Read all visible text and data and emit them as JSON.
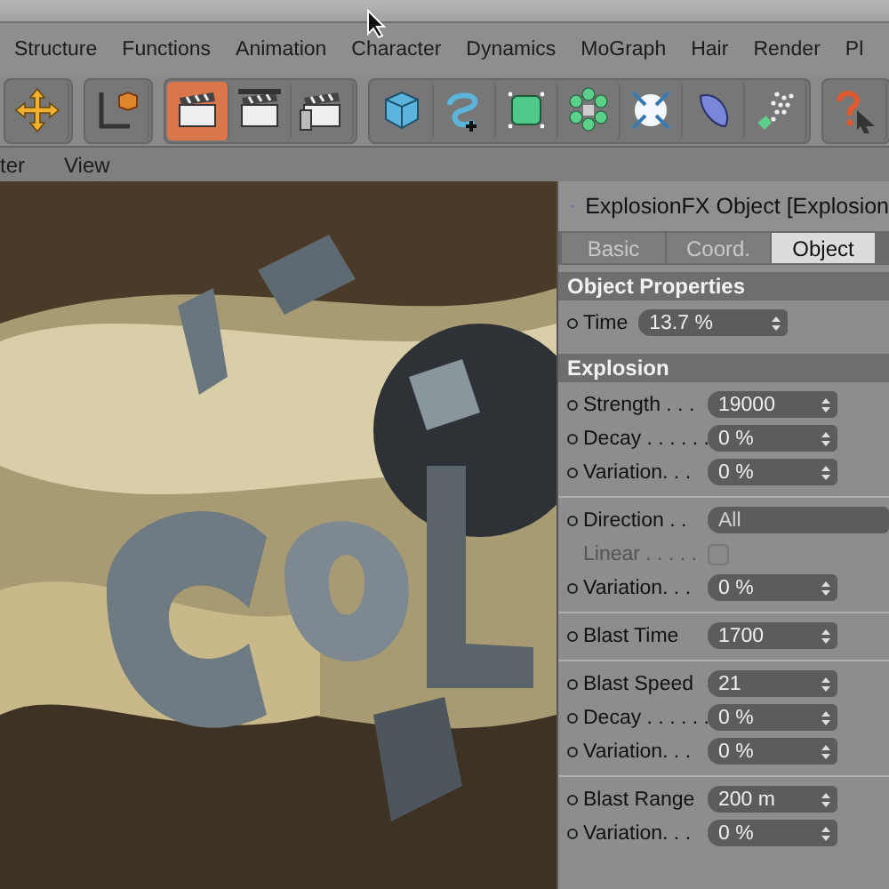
{
  "menu_bar": {
    "items": [
      "Structure",
      "Functions",
      "Animation",
      "Character",
      "Dynamics",
      "MoGraph",
      "Hair",
      "Render",
      "Pl"
    ]
  },
  "toolbar": {
    "groups": [
      {
        "buttons": [
          {
            "kind": "move",
            "selected": false
          }
        ]
      },
      {
        "buttons": [
          {
            "kind": "axis",
            "selected": false
          }
        ]
      },
      {
        "buttons": [
          {
            "kind": "render-view",
            "selected": true
          },
          {
            "kind": "render-picture",
            "selected": false
          },
          {
            "kind": "render-settings",
            "selected": false
          }
        ]
      },
      {
        "buttons": [
          {
            "kind": "cube",
            "selected": false
          },
          {
            "kind": "spline",
            "selected": false
          },
          {
            "kind": "nurbs",
            "selected": false
          },
          {
            "kind": "array",
            "selected": false
          },
          {
            "kind": "deformer",
            "selected": false
          },
          {
            "kind": "half-sphere",
            "selected": false
          },
          {
            "kind": "particles",
            "selected": false
          }
        ]
      },
      {
        "buttons": [
          {
            "kind": "help",
            "selected": false
          }
        ]
      }
    ]
  },
  "viewport_menu": {
    "items": [
      "ter",
      "View"
    ]
  },
  "attributes": {
    "title": "ExplosionFX Object [Explosion",
    "tabs": [
      {
        "label": "Basic",
        "selected": false
      },
      {
        "label": "Coord.",
        "selected": false
      },
      {
        "label": "Object",
        "selected": true
      }
    ],
    "sections": [
      {
        "title": "Object Properties",
        "groups": [
          [
            {
              "kind": "number",
              "label": "Time",
              "value": "13.7 %",
              "compact": true,
              "keyframe_dot": true
            }
          ]
        ]
      },
      {
        "title": "Explosion",
        "groups": [
          [
            {
              "kind": "number",
              "label": "Strength . . .",
              "value": "19000",
              "keyframe_dot": true
            },
            {
              "kind": "number",
              "label": "Decay . . . . . .",
              "value": "0 %",
              "keyframe_dot": true
            },
            {
              "kind": "number",
              "label": "Variation. . .",
              "value": "0 %",
              "keyframe_dot": true
            }
          ],
          [
            {
              "kind": "dropdown",
              "label": "Direction . .",
              "value": "All",
              "keyframe_dot": true
            },
            {
              "kind": "checkbox",
              "label": "Linear . . . . .",
              "checked": false,
              "disabled": true,
              "keyframe_dot": false
            },
            {
              "kind": "number",
              "label": "Variation. . .",
              "value": "0 %",
              "keyframe_dot": true
            }
          ],
          [
            {
              "kind": "number",
              "label": "Blast Time",
              "value": "1700",
              "keyframe_dot": true
            }
          ],
          [
            {
              "kind": "number",
              "label": "Blast Speed",
              "value": "21",
              "keyframe_dot": true
            },
            {
              "kind": "number",
              "label": "Decay . . . . . .",
              "value": "0 %",
              "keyframe_dot": true
            },
            {
              "kind": "number",
              "label": "Variation. . .",
              "value": "0 %",
              "keyframe_dot": true
            }
          ],
          [
            {
              "kind": "number",
              "label": "Blast Range",
              "value": "200 m",
              "keyframe_dot": true
            },
            {
              "kind": "number",
              "label": "Variation. . .",
              "value": "0 %",
              "keyframe_dot": true
            }
          ]
        ]
      }
    ]
  }
}
